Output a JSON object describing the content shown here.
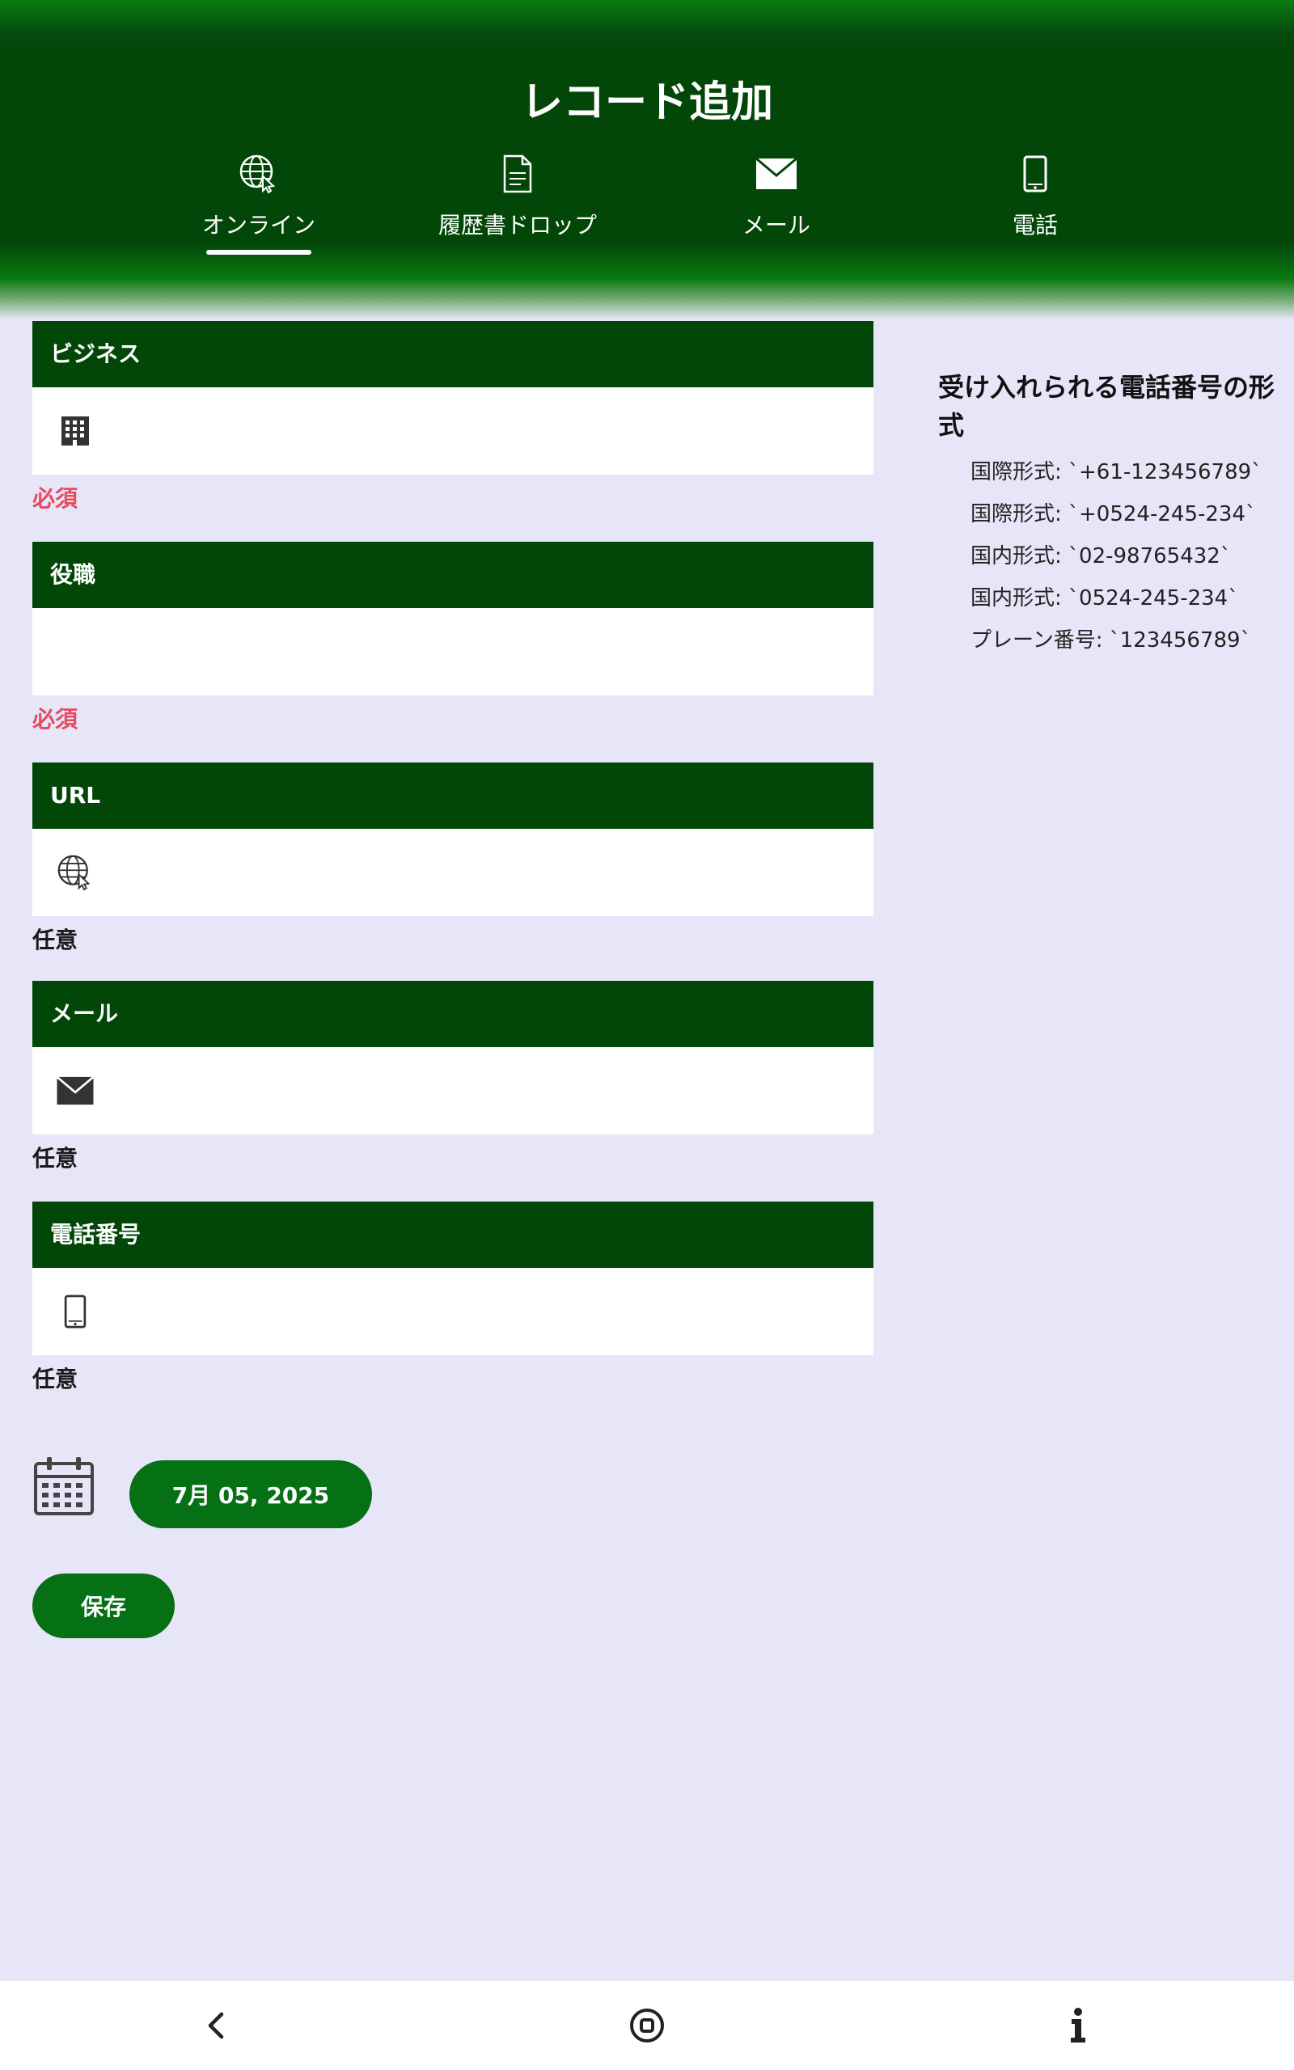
{
  "header": {
    "title": "レコード追加",
    "tabs": [
      {
        "label": "オンライン",
        "icon": "globe-cursor-icon",
        "active": true
      },
      {
        "label": "履歴書ドロップ",
        "icon": "document-icon",
        "active": false
      },
      {
        "label": "メール",
        "icon": "envelope-icon",
        "active": false
      },
      {
        "label": "電話",
        "icon": "smartphone-icon",
        "active": false
      }
    ]
  },
  "form": {
    "fields": [
      {
        "label": "ビジネス",
        "icon": "building-icon",
        "value": "",
        "note": "必須"
      },
      {
        "label": "役職",
        "icon": "",
        "value": "",
        "note": "必須"
      },
      {
        "label": "URL",
        "icon": "globe-cursor-icon",
        "value": "",
        "note": "任意"
      },
      {
        "label": "メール",
        "icon": "envelope-icon",
        "value": "",
        "note": "任意"
      },
      {
        "label": "電話番号",
        "icon": "smartphone-icon",
        "value": "",
        "note": "任意"
      }
    ],
    "date_label": "7月 05, 2025",
    "save_label": "保存"
  },
  "formats": {
    "title": "受け入れられる電話番号の形式",
    "items": [
      "国際形式: `+61-123456789`",
      "国際形式: `+0524-245-234`",
      "国内形式: `02-98765432`",
      "国内形式: `0524-245-234`",
      "プレーン番号: `123456789`"
    ]
  },
  "colors": {
    "header_green": "#024708",
    "button_green": "#067014",
    "required_red": "#e84a5f",
    "background": "#e6e6f8"
  },
  "navbar": {
    "icons": [
      "back-icon",
      "home-icon",
      "info-icon"
    ]
  }
}
